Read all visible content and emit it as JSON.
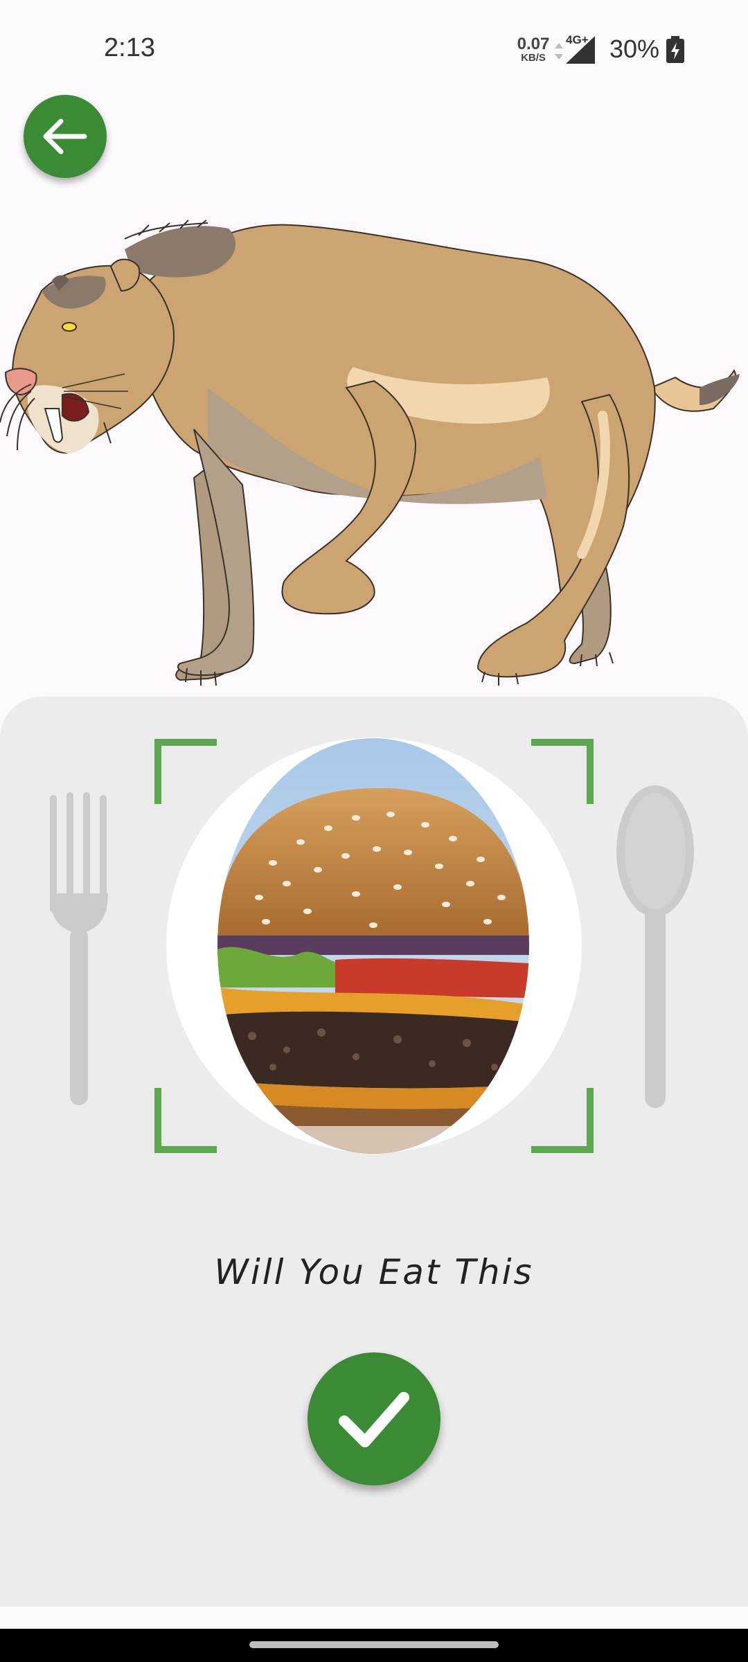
{
  "status_bar": {
    "time": "2:13",
    "net_speed_value": "0.07",
    "net_speed_unit": "KB/S",
    "network_type": "4G+",
    "battery_percent": "30%"
  },
  "icons": {
    "back": "arrow-left-icon",
    "fork": "fork-icon",
    "spoon": "spoon-icon",
    "confirm": "checkmark-icon"
  },
  "main": {
    "animal": "saber-toothed cat illustration",
    "food": "hamburger",
    "question": "Will You Eat This"
  },
  "colors": {
    "accent_green": "#3a8a36",
    "frame_green": "#5ca84f",
    "panel_background": "#ececec",
    "page_background": "#fdf9fc"
  }
}
